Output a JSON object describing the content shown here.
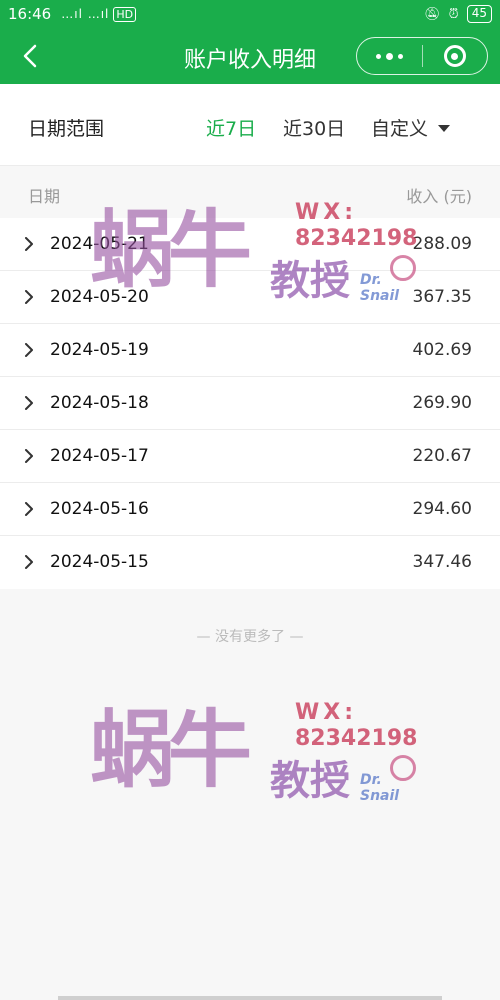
{
  "status_bar": {
    "time": "16:46",
    "signal": "…ıl …ıl",
    "network": "HD",
    "battery": "45"
  },
  "nav": {
    "title": "账户收入明细"
  },
  "filter": {
    "label": "日期范围",
    "tabs": [
      {
        "label": "近7日",
        "active": true
      },
      {
        "label": "近30日",
        "active": false
      },
      {
        "label": "自定义",
        "active": false
      }
    ]
  },
  "table": {
    "col_date": "日期",
    "col_income": "收入 (元)",
    "rows": [
      {
        "date": "2024-05-21",
        "amount": "288.09"
      },
      {
        "date": "2024-05-20",
        "amount": "367.35"
      },
      {
        "date": "2024-05-19",
        "amount": "402.69"
      },
      {
        "date": "2024-05-18",
        "amount": "269.90"
      },
      {
        "date": "2024-05-17",
        "amount": "220.67"
      },
      {
        "date": "2024-05-16",
        "amount": "294.60"
      },
      {
        "date": "2024-05-15",
        "amount": "347.46"
      }
    ]
  },
  "footer_text": "— 没有更多了 —",
  "watermark": {
    "big": "蜗牛",
    "mid": "教授",
    "wx": "WX:",
    "number": "82342198",
    "tag": "Dr. Snail"
  },
  "colors": {
    "brand_green": "#1aad4b"
  }
}
